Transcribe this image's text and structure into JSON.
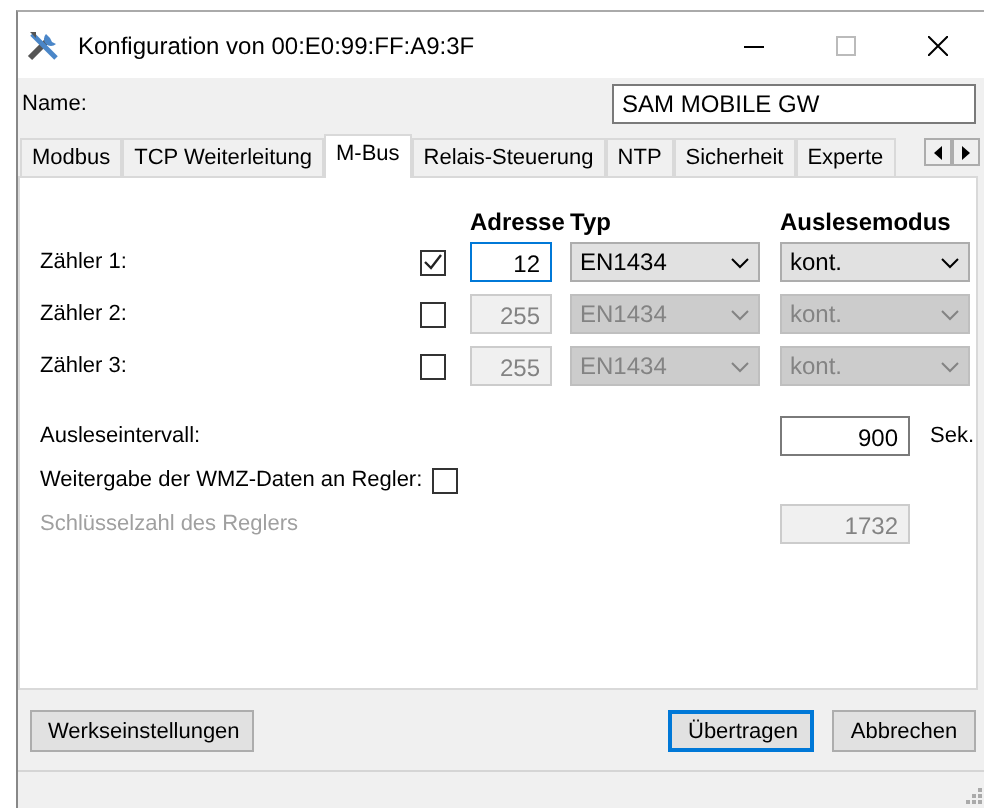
{
  "window": {
    "title": "Konfiguration von 00:E0:99:FF:A9:3F"
  },
  "name_field": {
    "label": "Name:",
    "value": "SAM MOBILE GW"
  },
  "tabs": [
    {
      "label": "Modbus",
      "selected": false
    },
    {
      "label": "TCP Weiterleitung",
      "selected": false
    },
    {
      "label": "M-Bus",
      "selected": true
    },
    {
      "label": "Relais-Steuerung",
      "selected": false
    },
    {
      "label": "NTP",
      "selected": false
    },
    {
      "label": "Sicherheit",
      "selected": false
    },
    {
      "label": "Experte",
      "selected": false
    }
  ],
  "meter_columns": [
    "Adresse",
    "Typ",
    "Auslesemodus"
  ],
  "meters": [
    {
      "label": "Zähler 1:",
      "checked": true,
      "focused": true,
      "address": "12",
      "type": "EN1434",
      "mode": "kont."
    },
    {
      "label": "Zähler 2:",
      "checked": false,
      "focused": false,
      "address": "255",
      "type": "EN1434",
      "mode": "kont."
    },
    {
      "label": "Zähler 3:",
      "checked": false,
      "focused": false,
      "address": "255",
      "type": "EN1434",
      "mode": "kont."
    }
  ],
  "interval": {
    "label": "Ausleseintervall:",
    "value": "900",
    "unit": "Sek."
  },
  "forward": {
    "label": "Weitergabe der WMZ-Daten an Regler:",
    "checked": false
  },
  "key": {
    "label": "Schlüsselzahl des Reglers",
    "value": "1732",
    "disabled": true
  },
  "buttons": [
    {
      "label": "Werkseinstellungen",
      "default": false
    },
    {
      "label": "Übertragen",
      "default": true
    },
    {
      "label": "Abbrechen",
      "default": false
    }
  ]
}
